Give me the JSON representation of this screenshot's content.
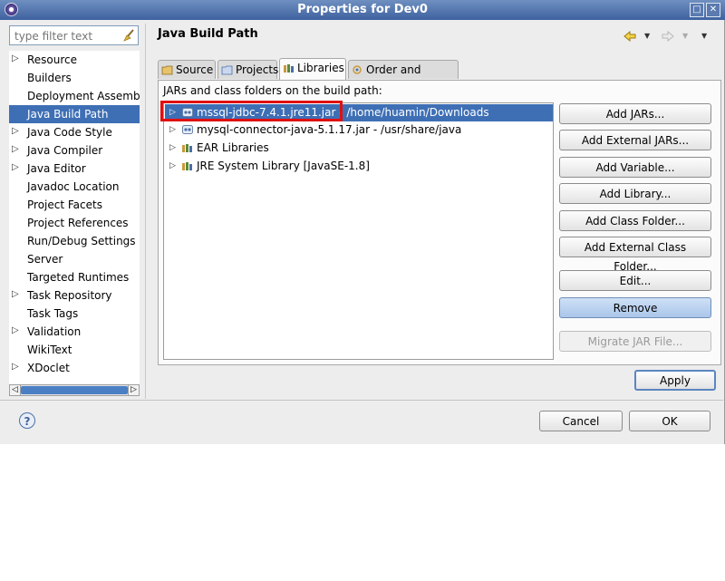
{
  "window": {
    "title": "Properties for Dev0",
    "buttons": [
      "□",
      "✕"
    ]
  },
  "filter": {
    "placeholder": "type filter text"
  },
  "nav": {
    "items": [
      {
        "label": "Resource",
        "expandable": true
      },
      {
        "label": "Builders",
        "expandable": false
      },
      {
        "label": "Deployment Assembly",
        "expandable": false
      },
      {
        "label": "Java Build Path",
        "expandable": false,
        "selected": true
      },
      {
        "label": "Java Code Style",
        "expandable": true
      },
      {
        "label": "Java Compiler",
        "expandable": true
      },
      {
        "label": "Java Editor",
        "expandable": true
      },
      {
        "label": "Javadoc Location",
        "expandable": false
      },
      {
        "label": "Project Facets",
        "expandable": false
      },
      {
        "label": "Project References",
        "expandable": false
      },
      {
        "label": "Run/Debug Settings",
        "expandable": false
      },
      {
        "label": "Server",
        "expandable": false
      },
      {
        "label": "Targeted Runtimes",
        "expandable": false
      },
      {
        "label": "Task Repository",
        "expandable": true
      },
      {
        "label": "Task Tags",
        "expandable": false
      },
      {
        "label": "Validation",
        "expandable": true
      },
      {
        "label": "WikiText",
        "expandable": false
      },
      {
        "label": "XDoclet",
        "expandable": true
      }
    ]
  },
  "page": {
    "title": "Java Build Path"
  },
  "tabs": [
    {
      "label": "Source",
      "icon": "source-folder-icon"
    },
    {
      "label": "Projects",
      "icon": "projects-icon"
    },
    {
      "label": "Libraries",
      "icon": "libraries-icon",
      "active": true
    },
    {
      "label": "Order and Export",
      "icon": "order-export-icon"
    }
  ],
  "libraries": {
    "heading": "JARs and class folders on the build path:",
    "entries": [
      {
        "text": "mssql-jdbc-7.4.1.jre11.jar - /home/huamin/Downloads",
        "icon": "jar-icon",
        "selected": true
      },
      {
        "text": "mysql-connector-java-5.1.17.jar - /usr/share/java",
        "icon": "jar-icon"
      },
      {
        "text": "EAR Libraries",
        "icon": "library-icon"
      },
      {
        "text": "JRE System Library [JavaSE-1.8]",
        "icon": "library-icon"
      }
    ],
    "buttons": {
      "add_jars": "Add JARs...",
      "add_external_jars": "Add External JARs...",
      "add_variable": "Add Variable...",
      "add_library": "Add Library...",
      "add_class_folder": "Add Class Folder...",
      "add_external_class_folder": "Add External Class Folder...",
      "edit": "Edit...",
      "remove": "Remove",
      "migrate_jar": "Migrate JAR File..."
    }
  },
  "footer": {
    "apply": "Apply",
    "cancel": "Cancel",
    "ok": "OK",
    "help": "?"
  },
  "colors": {
    "selection": "#3e6fb5",
    "highlight_box": "#e01010",
    "titlebar": "#4a6ba8"
  }
}
